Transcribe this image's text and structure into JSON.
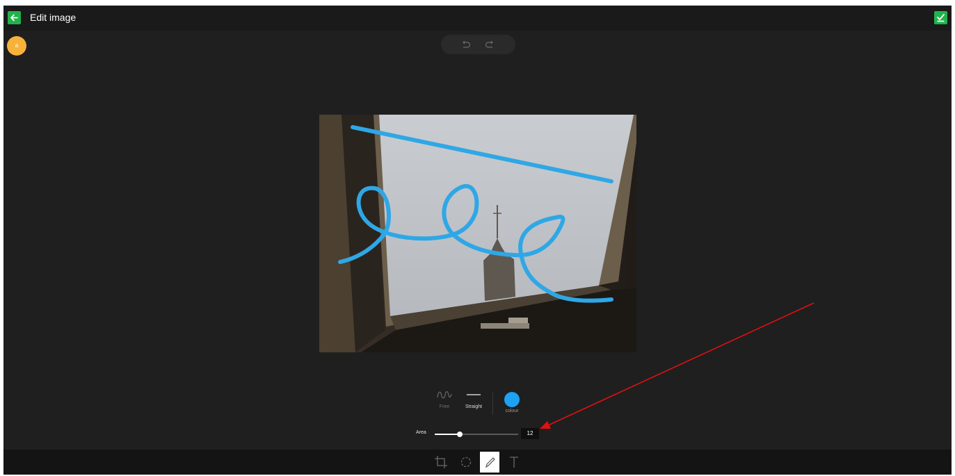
{
  "header": {
    "title": "Edit image"
  },
  "avatar": {
    "initial": "a"
  },
  "draw_tools": {
    "free_label": "Free",
    "straight_label": "Straight",
    "colour_label": "colour",
    "selected_tool": "Straight",
    "colour": "#1da1f2"
  },
  "area": {
    "label": "Area",
    "value": "12",
    "slider_fraction": 0.3
  },
  "bottom_tools": [
    "crop-icon",
    "rotate-icon",
    "pencil-icon",
    "text-icon"
  ],
  "colors": {
    "accent_green": "#22b24c",
    "avatar_bg": "#f7b23b",
    "stroke_blue": "#2fa7e6",
    "annotation_arrow": "#e01010"
  }
}
